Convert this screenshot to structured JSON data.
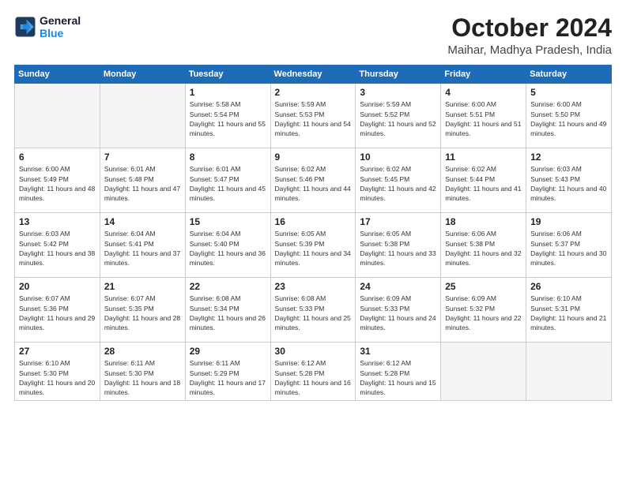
{
  "header": {
    "logo_line1": "General",
    "logo_line2": "Blue",
    "month": "October 2024",
    "location": "Maihar, Madhya Pradesh, India"
  },
  "weekdays": [
    "Sunday",
    "Monday",
    "Tuesday",
    "Wednesday",
    "Thursday",
    "Friday",
    "Saturday"
  ],
  "weeks": [
    [
      {
        "day": "",
        "empty": true
      },
      {
        "day": "",
        "empty": true
      },
      {
        "day": "1",
        "sunrise": "Sunrise: 5:58 AM",
        "sunset": "Sunset: 5:54 PM",
        "daylight": "Daylight: 11 hours and 55 minutes."
      },
      {
        "day": "2",
        "sunrise": "Sunrise: 5:59 AM",
        "sunset": "Sunset: 5:53 PM",
        "daylight": "Daylight: 11 hours and 54 minutes."
      },
      {
        "day": "3",
        "sunrise": "Sunrise: 5:59 AM",
        "sunset": "Sunset: 5:52 PM",
        "daylight": "Daylight: 11 hours and 52 minutes."
      },
      {
        "day": "4",
        "sunrise": "Sunrise: 6:00 AM",
        "sunset": "Sunset: 5:51 PM",
        "daylight": "Daylight: 11 hours and 51 minutes."
      },
      {
        "day": "5",
        "sunrise": "Sunrise: 6:00 AM",
        "sunset": "Sunset: 5:50 PM",
        "daylight": "Daylight: 11 hours and 49 minutes."
      }
    ],
    [
      {
        "day": "6",
        "sunrise": "Sunrise: 6:00 AM",
        "sunset": "Sunset: 5:49 PM",
        "daylight": "Daylight: 11 hours and 48 minutes."
      },
      {
        "day": "7",
        "sunrise": "Sunrise: 6:01 AM",
        "sunset": "Sunset: 5:48 PM",
        "daylight": "Daylight: 11 hours and 47 minutes."
      },
      {
        "day": "8",
        "sunrise": "Sunrise: 6:01 AM",
        "sunset": "Sunset: 5:47 PM",
        "daylight": "Daylight: 11 hours and 45 minutes."
      },
      {
        "day": "9",
        "sunrise": "Sunrise: 6:02 AM",
        "sunset": "Sunset: 5:46 PM",
        "daylight": "Daylight: 11 hours and 44 minutes."
      },
      {
        "day": "10",
        "sunrise": "Sunrise: 6:02 AM",
        "sunset": "Sunset: 5:45 PM",
        "daylight": "Daylight: 11 hours and 42 minutes."
      },
      {
        "day": "11",
        "sunrise": "Sunrise: 6:02 AM",
        "sunset": "Sunset: 5:44 PM",
        "daylight": "Daylight: 11 hours and 41 minutes."
      },
      {
        "day": "12",
        "sunrise": "Sunrise: 6:03 AM",
        "sunset": "Sunset: 5:43 PM",
        "daylight": "Daylight: 11 hours and 40 minutes."
      }
    ],
    [
      {
        "day": "13",
        "sunrise": "Sunrise: 6:03 AM",
        "sunset": "Sunset: 5:42 PM",
        "daylight": "Daylight: 11 hours and 38 minutes."
      },
      {
        "day": "14",
        "sunrise": "Sunrise: 6:04 AM",
        "sunset": "Sunset: 5:41 PM",
        "daylight": "Daylight: 11 hours and 37 minutes."
      },
      {
        "day": "15",
        "sunrise": "Sunrise: 6:04 AM",
        "sunset": "Sunset: 5:40 PM",
        "daylight": "Daylight: 11 hours and 36 minutes."
      },
      {
        "day": "16",
        "sunrise": "Sunrise: 6:05 AM",
        "sunset": "Sunset: 5:39 PM",
        "daylight": "Daylight: 11 hours and 34 minutes."
      },
      {
        "day": "17",
        "sunrise": "Sunrise: 6:05 AM",
        "sunset": "Sunset: 5:38 PM",
        "daylight": "Daylight: 11 hours and 33 minutes."
      },
      {
        "day": "18",
        "sunrise": "Sunrise: 6:06 AM",
        "sunset": "Sunset: 5:38 PM",
        "daylight": "Daylight: 11 hours and 32 minutes."
      },
      {
        "day": "19",
        "sunrise": "Sunrise: 6:06 AM",
        "sunset": "Sunset: 5:37 PM",
        "daylight": "Daylight: 11 hours and 30 minutes."
      }
    ],
    [
      {
        "day": "20",
        "sunrise": "Sunrise: 6:07 AM",
        "sunset": "Sunset: 5:36 PM",
        "daylight": "Daylight: 11 hours and 29 minutes."
      },
      {
        "day": "21",
        "sunrise": "Sunrise: 6:07 AM",
        "sunset": "Sunset: 5:35 PM",
        "daylight": "Daylight: 11 hours and 28 minutes."
      },
      {
        "day": "22",
        "sunrise": "Sunrise: 6:08 AM",
        "sunset": "Sunset: 5:34 PM",
        "daylight": "Daylight: 11 hours and 26 minutes."
      },
      {
        "day": "23",
        "sunrise": "Sunrise: 6:08 AM",
        "sunset": "Sunset: 5:33 PM",
        "daylight": "Daylight: 11 hours and 25 minutes."
      },
      {
        "day": "24",
        "sunrise": "Sunrise: 6:09 AM",
        "sunset": "Sunset: 5:33 PM",
        "daylight": "Daylight: 11 hours and 24 minutes."
      },
      {
        "day": "25",
        "sunrise": "Sunrise: 6:09 AM",
        "sunset": "Sunset: 5:32 PM",
        "daylight": "Daylight: 11 hours and 22 minutes."
      },
      {
        "day": "26",
        "sunrise": "Sunrise: 6:10 AM",
        "sunset": "Sunset: 5:31 PM",
        "daylight": "Daylight: 11 hours and 21 minutes."
      }
    ],
    [
      {
        "day": "27",
        "sunrise": "Sunrise: 6:10 AM",
        "sunset": "Sunset: 5:30 PM",
        "daylight": "Daylight: 11 hours and 20 minutes."
      },
      {
        "day": "28",
        "sunrise": "Sunrise: 6:11 AM",
        "sunset": "Sunset: 5:30 PM",
        "daylight": "Daylight: 11 hours and 18 minutes."
      },
      {
        "day": "29",
        "sunrise": "Sunrise: 6:11 AM",
        "sunset": "Sunset: 5:29 PM",
        "daylight": "Daylight: 11 hours and 17 minutes."
      },
      {
        "day": "30",
        "sunrise": "Sunrise: 6:12 AM",
        "sunset": "Sunset: 5:28 PM",
        "daylight": "Daylight: 11 hours and 16 minutes."
      },
      {
        "day": "31",
        "sunrise": "Sunrise: 6:12 AM",
        "sunset": "Sunset: 5:28 PM",
        "daylight": "Daylight: 11 hours and 15 minutes."
      },
      {
        "day": "",
        "empty": true
      },
      {
        "day": "",
        "empty": true
      }
    ]
  ]
}
